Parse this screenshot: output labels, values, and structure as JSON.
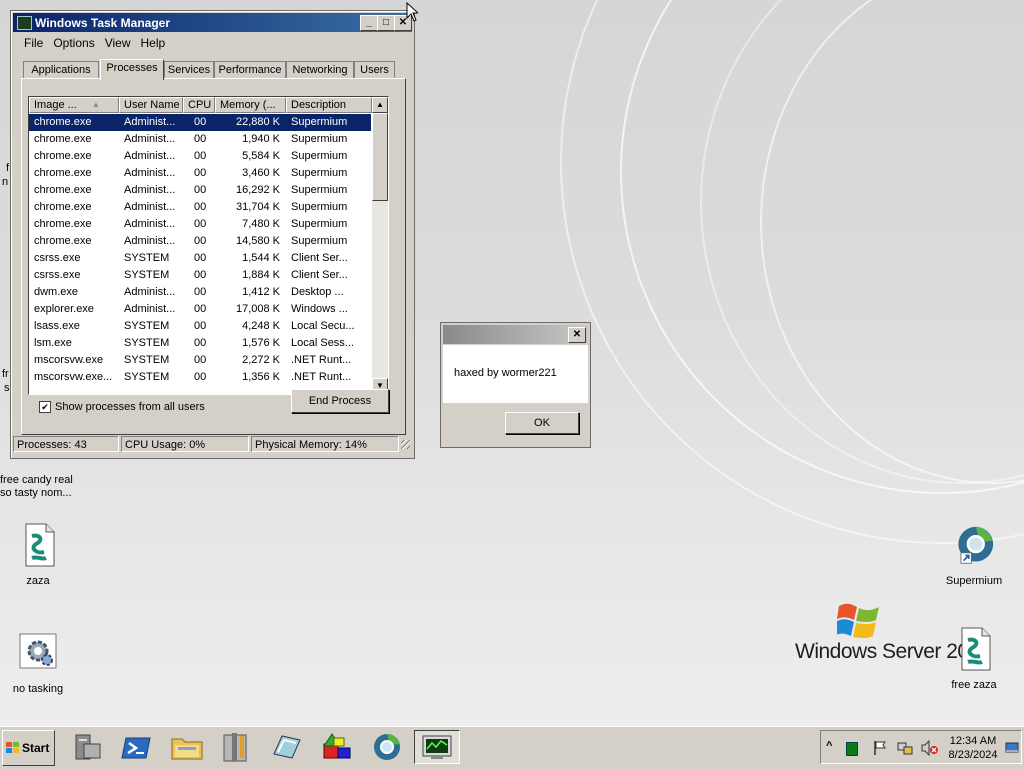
{
  "desktop": {
    "icons": [
      {
        "id": "free-candy",
        "label": "free candy real so tasty nom..."
      },
      {
        "id": "zaza",
        "label": "zaza"
      },
      {
        "id": "no-tasking",
        "label": "no tasking"
      },
      {
        "id": "supermium",
        "label": "Supermium"
      },
      {
        "id": "free-zaza",
        "label": "free zaza"
      }
    ],
    "partial_labels": [
      "f",
      "n",
      "fr",
      "s"
    ],
    "branding": "Windows Server 20"
  },
  "task_manager": {
    "title": "Windows Task Manager",
    "controls": {
      "minimize": "_",
      "maximize": "□",
      "close": "✕"
    },
    "menu": [
      "File",
      "Options",
      "View",
      "Help"
    ],
    "tabs": [
      "Applications",
      "Processes",
      "Services",
      "Performance",
      "Networking",
      "Users"
    ],
    "active_tab": "Processes",
    "columns": [
      "Image ...",
      "User Name",
      "CPU",
      "Memory (...",
      "Description"
    ],
    "rows": [
      [
        "chrome.exe",
        "Administ...",
        "00",
        "22,880 K",
        "Supermium"
      ],
      [
        "chrome.exe",
        "Administ...",
        "00",
        "1,940 K",
        "Supermium"
      ],
      [
        "chrome.exe",
        "Administ...",
        "00",
        "5,584 K",
        "Supermium"
      ],
      [
        "chrome.exe",
        "Administ...",
        "00",
        "3,460 K",
        "Supermium"
      ],
      [
        "chrome.exe",
        "Administ...",
        "00",
        "16,292 K",
        "Supermium"
      ],
      [
        "chrome.exe",
        "Administ...",
        "00",
        "31,704 K",
        "Supermium"
      ],
      [
        "chrome.exe",
        "Administ...",
        "00",
        "7,480 K",
        "Supermium"
      ],
      [
        "chrome.exe",
        "Administ...",
        "00",
        "14,580 K",
        "Supermium"
      ],
      [
        "csrss.exe",
        "SYSTEM",
        "00",
        "1,544 K",
        "Client Ser..."
      ],
      [
        "csrss.exe",
        "SYSTEM",
        "00",
        "1,884 K",
        "Client Ser..."
      ],
      [
        "dwm.exe",
        "Administ...",
        "00",
        "1,412 K",
        "Desktop ..."
      ],
      [
        "explorer.exe",
        "Administ...",
        "00",
        "17,008 K",
        "Windows ..."
      ],
      [
        "lsass.exe",
        "SYSTEM",
        "00",
        "4,248 K",
        "Local Secu..."
      ],
      [
        "lsm.exe",
        "SYSTEM",
        "00",
        "1,576 K",
        "Local Sess..."
      ],
      [
        "mscorsvw.exe",
        "SYSTEM",
        "00",
        "2,272 K",
        ".NET Runt..."
      ],
      [
        "mscorsvw.exe...",
        "SYSTEM",
        "00",
        "1,356 K",
        ".NET Runt..."
      ]
    ],
    "show_all_label": "Show processes from all users",
    "show_all_checked": true,
    "end_process_label": "End Process",
    "status": {
      "processes": "Processes: 43",
      "cpu": "CPU Usage: 0%",
      "memory": "Physical Memory: 14%"
    }
  },
  "message_box": {
    "text": "haxed by wormer221",
    "ok_label": "OK",
    "close": "✕"
  },
  "taskbar": {
    "start_label": "Start",
    "clock_time": "12:34 AM",
    "clock_date": "8/23/2024",
    "tray_expand": "^"
  },
  "colors": {
    "selection": "#0a246a",
    "title_active": "#0a246a",
    "face": "#d4d0c8"
  }
}
